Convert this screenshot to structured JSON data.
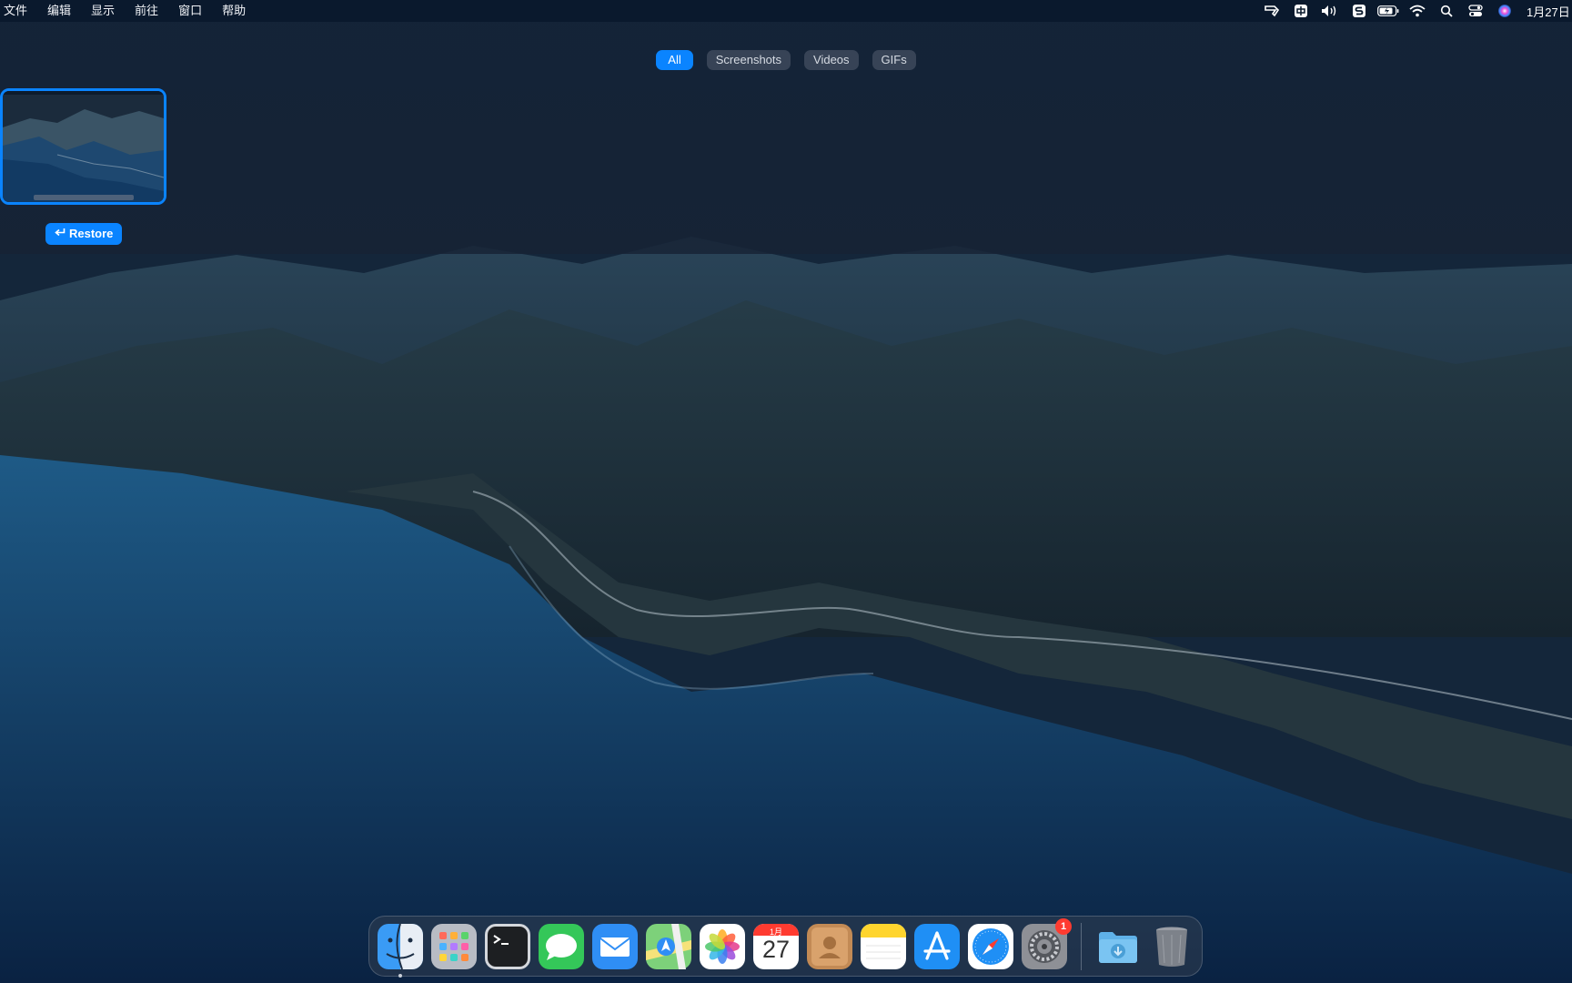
{
  "menubar": {
    "items": [
      "文件",
      "编辑",
      "显示",
      "前往",
      "窗口",
      "帮助"
    ],
    "clock": "1月27日"
  },
  "status_icons": [
    "screenshot-tool-icon",
    "input-method-icon",
    "volume-icon",
    "app-s-icon",
    "battery-icon",
    "wifi-icon",
    "spotlight-search-icon",
    "control-center-icon",
    "siri-icon"
  ],
  "history": {
    "tabs": [
      {
        "label": "All",
        "active": true
      },
      {
        "label": "Screenshots",
        "active": false
      },
      {
        "label": "Videos",
        "active": false
      },
      {
        "label": "GIFs",
        "active": false
      }
    ],
    "restore_label": "Restore",
    "restore_icon": "return-arrow-icon"
  },
  "dock": {
    "apps": [
      {
        "name": "finder",
        "icon": "finder-icon",
        "running": true
      },
      {
        "name": "launchpad",
        "icon": "launchpad-icon"
      },
      {
        "name": "terminal",
        "icon": "terminal-icon"
      },
      {
        "name": "messages",
        "icon": "messages-icon"
      },
      {
        "name": "mail",
        "icon": "mail-icon"
      },
      {
        "name": "maps",
        "icon": "maps-icon"
      },
      {
        "name": "photos",
        "icon": "photos-icon"
      },
      {
        "name": "calendar",
        "icon": "calendar-icon",
        "month": "1月",
        "day": "27"
      },
      {
        "name": "contacts",
        "icon": "contacts-icon"
      },
      {
        "name": "notes",
        "icon": "notes-icon"
      },
      {
        "name": "app-store",
        "icon": "app-store-icon"
      },
      {
        "name": "safari",
        "icon": "safari-icon"
      },
      {
        "name": "system-settings",
        "icon": "system-settings-icon",
        "badge": "1"
      },
      {
        "name": "downloads",
        "icon": "downloads-folder-icon"
      },
      {
        "name": "trash",
        "icon": "trash-icon"
      }
    ]
  },
  "colors": {
    "accent": "#0a84ff",
    "badge": "#ff3b30"
  }
}
